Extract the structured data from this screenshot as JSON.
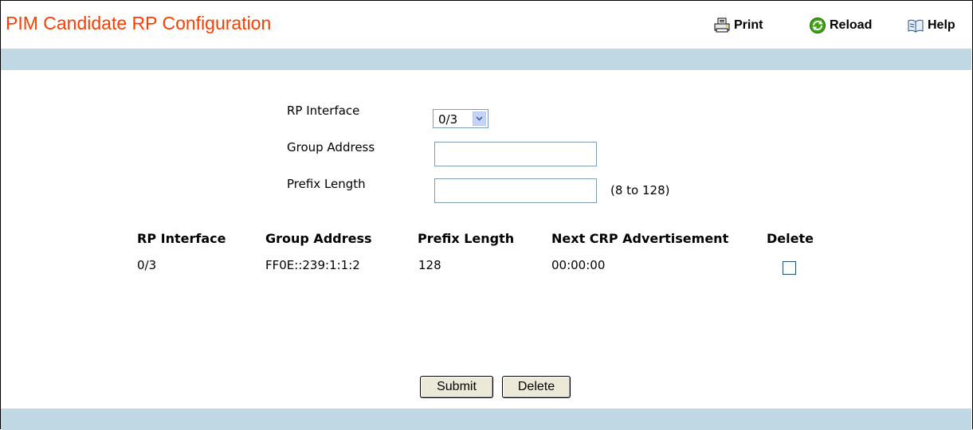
{
  "header": {
    "title": "PIM Candidate RP Configuration",
    "actions": [
      {
        "label": "Print",
        "icon": "printer-icon"
      },
      {
        "label": "Reload",
        "icon": "reload-icon"
      },
      {
        "label": "Help",
        "icon": "help-book-icon"
      }
    ]
  },
  "form": {
    "rp_interface_label": "RP Interface",
    "rp_interface_value": "0/3",
    "group_address_label": "Group Address",
    "group_address_value": "",
    "prefix_length_label": "Prefix Length",
    "prefix_length_value": "",
    "prefix_length_hint": "(8 to 128)"
  },
  "table": {
    "columns": [
      "RP Interface",
      "Group Address",
      "Prefix Length",
      "Next CRP Advertisement",
      "Delete"
    ],
    "rows": [
      {
        "rp_interface": "0/3",
        "group_address": "FF0E::239:1:1:2",
        "prefix_length": "128",
        "next_crp": "00:00:00",
        "delete_checked": false
      }
    ]
  },
  "buttons": {
    "submit": "Submit",
    "delete": "Delete"
  },
  "colors": {
    "title": "#ff3c00",
    "bar": "#c0d7e4"
  }
}
